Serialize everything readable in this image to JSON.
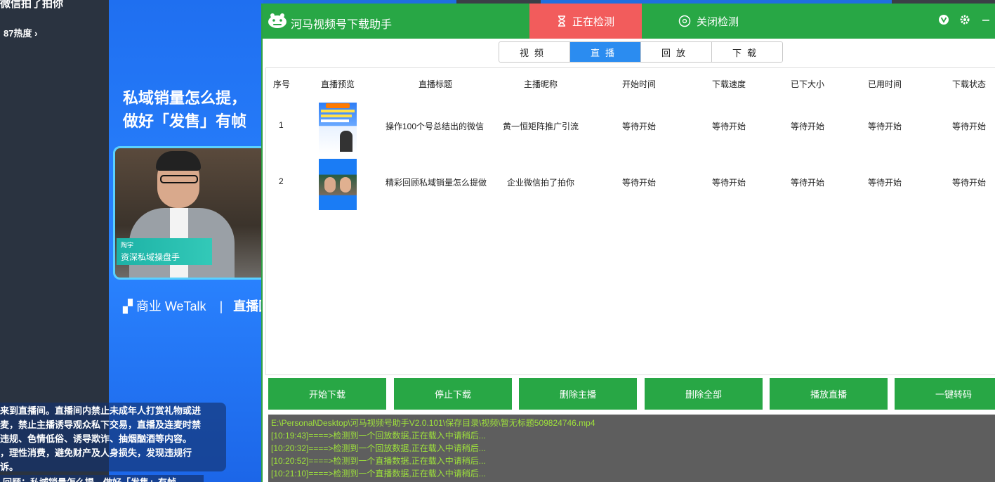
{
  "background": {
    "top_title": "微信拍了拍你",
    "heat": "87热度",
    "headline_1": "私域销量怎么提，",
    "headline_2": "做好「发售」有帧",
    "name_tag_small": "陶宇",
    "name_tag_title": "资深私域操盘手",
    "brand": "商业 WeTalk",
    "brand_suffix": "直播回",
    "notice_lines": [
      "来到直播间。直播间内禁止未成年人打赏礼物或进",
      "麦，禁止主播诱导观众私下交易，直播及连麦时禁",
      "违规、色情低俗、诱导欺诈、抽烟酗酒等内容。",
      "，理性消费，避免财产及人身损失，发现违规行",
      "诉。"
    ],
    "bottom_text": "回顾：私域销量怎么提，做好「发售」有帧"
  },
  "app": {
    "title": "河马视频号下载助手",
    "tab_detecting": "正在检测",
    "tab_close_detect": "关闭检测",
    "segment_tabs": [
      {
        "label": "视频",
        "active": false
      },
      {
        "label": "直播",
        "active": true
      },
      {
        "label": "回放",
        "active": false
      },
      {
        "label": "下载",
        "active": false
      }
    ],
    "columns": [
      "序号",
      "直播预览",
      "直播标题",
      "主播昵称",
      "开始时间",
      "下载速度",
      "已下大小",
      "已用时间",
      "下载状态"
    ],
    "rows": [
      {
        "index": "1",
        "title": "操作100个号总结出的微信",
        "host": "黄一恒矩阵推广引流",
        "start": "等待开始",
        "speed": "等待开始",
        "size": "等待开始",
        "elapsed": "等待开始",
        "status": "等待开始"
      },
      {
        "index": "2",
        "title": "精彩回顾私域销量怎么提做",
        "host": "企业微信拍了拍你",
        "start": "等待开始",
        "speed": "等待开始",
        "size": "等待开始",
        "elapsed": "等待开始",
        "status": "等待开始"
      }
    ],
    "buttons": [
      "开始下载",
      "停止下载",
      "删除主播",
      "删除全部",
      "播放直播",
      "一键转码"
    ],
    "log_lines": [
      "E:\\Personal\\Desktop\\河马视频号助手V2.0.101\\保存目录\\视频\\暂无标题509824746.mp4",
      "[10:19:43]====>检测到一个回放数据,正在载入中请稍后...",
      "[10:20:32]====>检测到一个回放数据,正在载入中请稍后...",
      "[10:20:52]====>检测到一个直播数据,正在载入中请稍后...",
      "[10:21:10]====>检测到一个直播数据,正在载入中请稍后..."
    ],
    "colors": {
      "green": "#28a745",
      "red_tab": "#f25c5c",
      "blue_tab": "#2b8cf0",
      "log_text": "#9ee23b"
    }
  }
}
